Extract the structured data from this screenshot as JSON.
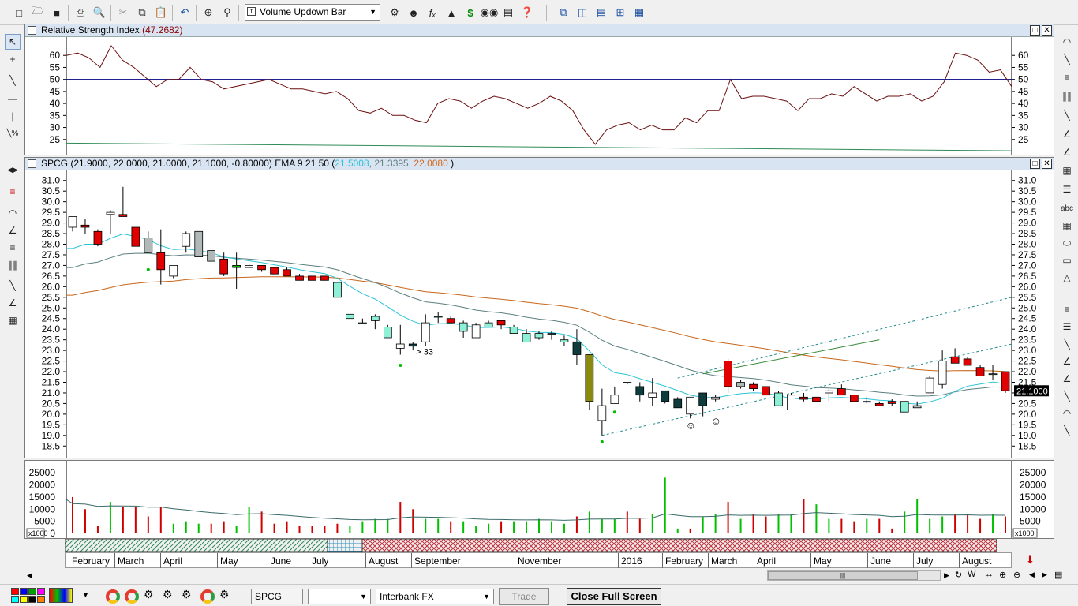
{
  "toolbar": {
    "symbol_dropdown": "Volume Updown Bar",
    "icons": [
      "new-icon",
      "open-icon",
      "save-icon",
      "print-icon",
      "print-preview-icon",
      "cut-icon",
      "copy-icon",
      "paste-icon",
      "undo-icon",
      "crosshair-icon",
      "zoom-icon",
      "indicator-icon",
      "expert-icon",
      "function-icon",
      "chart-icon",
      "dollar-icon",
      "binoculars-icon",
      "properties-icon",
      "help-icon",
      "window-cascade-icon",
      "tile-vertical-icon",
      "tile-horizontal-icon",
      "tile-grid-icon",
      "arrange-icon"
    ]
  },
  "rsi_panel": {
    "title_prefix": "Relative Strength Index",
    "title_value": "(47.2682)",
    "y_ticks": [
      "60",
      "55",
      "50",
      "45",
      "40",
      "35",
      "30",
      "25"
    ]
  },
  "price_panel": {
    "title_prefix": "SPCG (21.9000, 22.0000, 21.0000, 21.1000, -0.80000)",
    "title_ema": "EMA 9 21 50 (",
    "ema1": "21.5008",
    "ema2": "21.3395",
    "ema3": "22.0080",
    "title_close": ")",
    "y_ticks": [
      "31.0",
      "30.5",
      "30.0",
      "29.5",
      "29.0",
      "28.5",
      "28.0",
      "27.5",
      "27.0",
      "26.5",
      "26.0",
      "25.5",
      "25.0",
      "24.5",
      "24.0",
      "23.5",
      "23.0",
      "22.5",
      "22.0",
      "21.5",
      "21.0",
      "20.5",
      "20.0",
      "19.5",
      "19.0",
      "18.5"
    ],
    "last_price": "21.1000",
    "annotation": "> 33"
  },
  "volume_panel": {
    "y_ticks": [
      "25000",
      "20000",
      "15000",
      "10000",
      "5000",
      "0"
    ],
    "unit": "x1000"
  },
  "time_axis": {
    "labels": [
      "February",
      "March",
      "April",
      "May",
      "June",
      "July",
      "August",
      "September",
      "November",
      "2016",
      "February",
      "March",
      "April",
      "May",
      "June",
      "July",
      "August"
    ]
  },
  "status": {
    "symbol": "SPCG",
    "empty_dropdown": "",
    "feed": "Interbank FX",
    "trade_button": "Trade",
    "close_full_screen": "Close Full Screen",
    "palette_colors": [
      "#ff0000",
      "#0000ff",
      "#00a000",
      "#ff00ff",
      "#00ffff",
      "#ffff00",
      "#000000",
      "#ff8000"
    ]
  },
  "scroll_controls": [
    "W",
    "↔",
    "⊕",
    "⊖",
    "◀",
    "▶",
    "▤"
  ],
  "chart_data": {
    "type": "candlestick",
    "candles": [
      [
        29.3,
        29.3,
        28.6,
        28.8,
        "w"
      ],
      [
        28.9,
        29.2,
        28.5,
        28.8,
        "r"
      ],
      [
        28.6,
        28.7,
        27.9,
        28.0,
        "r"
      ],
      [
        29.5,
        29.6,
        28.5,
        29.4,
        "w"
      ],
      [
        29.4,
        30.7,
        29.3,
        29.3,
        "r"
      ],
      [
        28.8,
        28.4,
        28.4,
        27.9,
        "r"
      ],
      [
        28.3,
        28.6,
        27.8,
        27.6,
        "g"
      ],
      [
        27.6,
        28.7,
        26.1,
        26.8,
        "r"
      ],
      [
        26.5,
        27.0,
        26.4,
        27.0,
        "w"
      ],
      [
        28.5,
        28.6,
        27.6,
        27.9,
        "w"
      ],
      [
        28.6,
        27.8,
        27.6,
        27.4,
        "g"
      ],
      [
        27.7,
        27.7,
        27.2,
        27.2,
        "g"
      ],
      [
        27.3,
        27.6,
        26.5,
        26.6,
        "r"
      ],
      [
        27.0,
        27.6,
        25.9,
        26.9,
        "G"
      ],
      [
        27.0,
        27.1,
        26.9,
        26.9,
        "w"
      ],
      [
        27.0,
        27.0,
        26.7,
        26.8,
        "r"
      ],
      [
        26.9,
        26.8,
        26.6,
        26.6,
        "r"
      ],
      [
        26.8,
        26.9,
        26.6,
        26.5,
        "r"
      ],
      [
        26.5,
        26.6,
        26.3,
        26.3,
        "r"
      ],
      [
        26.5,
        26.5,
        26.3,
        26.3,
        "r"
      ],
      [
        26.5,
        26.5,
        26.4,
        26.3,
        "r"
      ],
      [
        26.2,
        26.2,
        25.8,
        25.5,
        "c"
      ],
      [
        24.7,
        24.7,
        24.5,
        24.5,
        "c"
      ],
      [
        24.3,
        24.5,
        24.3,
        24.3,
        "c"
      ],
      [
        24.6,
        24.7,
        24.0,
        24.4,
        "c"
      ],
      [
        24.1,
        24.2,
        23.7,
        23.6,
        "c"
      ],
      [
        23.3,
        24.2,
        22.8,
        23.1,
        "w"
      ],
      [
        23.3,
        23.4,
        23.0,
        23.2,
        "k"
      ],
      [
        24.3,
        24.7,
        23.2,
        23.4,
        "w"
      ],
      [
        24.6,
        24.8,
        24.3,
        24.6,
        "c"
      ],
      [
        24.5,
        24.6,
        24.3,
        24.3,
        "r"
      ],
      [
        24.3,
        24.4,
        23.6,
        23.9,
        "c"
      ],
      [
        24.2,
        24.3,
        23.9,
        23.6,
        "w"
      ],
      [
        24.3,
        24.4,
        24.1,
        24.1,
        "c"
      ],
      [
        24.4,
        24.4,
        24.0,
        24.2,
        "r"
      ],
      [
        24.1,
        24.2,
        23.9,
        23.8,
        "c"
      ],
      [
        23.8,
        24.0,
        23.4,
        23.4,
        "c"
      ],
      [
        23.8,
        23.9,
        23.5,
        23.6,
        "c"
      ],
      [
        23.8,
        23.9,
        23.5,
        23.8,
        "c"
      ],
      [
        23.5,
        23.7,
        23.2,
        23.4,
        "c"
      ],
      [
        23.4,
        24.0,
        22.3,
        22.8,
        "k"
      ],
      [
        22.8,
        22.8,
        20.2,
        20.6,
        "o"
      ],
      [
        20.4,
        21.2,
        19.0,
        19.7,
        "w"
      ],
      [
        20.9,
        21.3,
        20.5,
        20.5,
        "w"
      ],
      [
        21.5,
        21.5,
        21.4,
        21.5,
        "k"
      ],
      [
        21.3,
        21.5,
        20.6,
        20.9,
        "k"
      ],
      [
        21.0,
        21.7,
        20.4,
        20.8,
        "w"
      ],
      [
        21.1,
        21.1,
        20.5,
        20.6,
        "k"
      ],
      [
        20.7,
        20.8,
        20.7,
        20.3,
        "k"
      ],
      [
        20.8,
        20.8,
        19.8,
        20.0,
        "w"
      ],
      [
        21.0,
        21.0,
        19.9,
        20.4,
        "k"
      ],
      [
        20.8,
        20.9,
        20.6,
        20.7,
        "w"
      ],
      [
        22.5,
        22.6,
        21.0,
        21.3,
        "r"
      ],
      [
        21.5,
        21.6,
        21.2,
        21.3,
        "g"
      ],
      [
        21.4,
        21.5,
        21.1,
        21.2,
        "r"
      ],
      [
        21.3,
        21.2,
        21.0,
        20.9,
        "r"
      ],
      [
        21.0,
        21.1,
        20.6,
        20.4,
        "c"
      ],
      [
        20.9,
        21.0,
        20.5,
        20.2,
        "w"
      ],
      [
        20.8,
        21.0,
        20.6,
        20.7,
        "r"
      ],
      [
        20.8,
        20.8,
        20.6,
        20.6,
        "r"
      ],
      [
        21.1,
        21.2,
        20.6,
        21.0,
        "w"
      ],
      [
        21.2,
        21.4,
        20.9,
        20.9,
        "r"
      ],
      [
        20.9,
        20.9,
        20.6,
        20.6,
        "r"
      ],
      [
        20.6,
        20.8,
        20.5,
        20.6,
        "g"
      ],
      [
        20.5,
        20.6,
        20.4,
        20.4,
        "r"
      ],
      [
        20.6,
        20.7,
        20.4,
        20.5,
        "r"
      ],
      [
        20.6,
        20.6,
        20.3,
        20.1,
        "c"
      ],
      [
        20.4,
        20.6,
        20.3,
        20.3,
        "g"
      ],
      [
        21.7,
        21.8,
        21.0,
        21.0,
        "w"
      ],
      [
        22.5,
        23.0,
        21.2,
        21.4,
        "w"
      ],
      [
        22.7,
        23.1,
        22.4,
        22.4,
        "r"
      ],
      [
        22.6,
        22.7,
        22.4,
        22.3,
        "r"
      ],
      [
        22.2,
        22.3,
        21.8,
        21.8,
        "r"
      ],
      [
        21.9,
        22.3,
        21.6,
        21.9,
        "c"
      ],
      [
        22.0,
        22.0,
        21.0,
        21.1,
        "r"
      ]
    ],
    "volume": [
      15,
      10,
      3,
      13,
      11,
      11,
      7,
      11,
      4,
      5,
      4,
      4,
      5,
      3,
      11,
      9,
      4,
      5,
      3,
      3,
      3,
      4,
      3,
      5,
      6,
      6,
      13,
      10,
      6,
      6,
      5,
      5,
      3,
      4,
      5,
      5,
      5,
      6,
      5,
      4,
      7,
      9,
      6,
      6,
      9,
      6,
      8,
      23,
      2,
      2,
      7,
      8,
      13,
      6,
      8,
      7,
      8,
      8,
      14,
      12,
      6,
      6,
      5,
      6,
      6,
      2,
      9,
      14,
      6,
      7,
      8,
      8,
      6,
      8,
      7,
      9,
      10,
      18,
      26,
      8,
      10,
      15,
      7,
      8
    ],
    "volume_up": [
      false,
      false,
      false,
      true,
      false,
      false,
      false,
      false,
      true,
      true,
      true,
      false,
      false,
      true,
      true,
      false,
      false,
      false,
      false,
      false,
      false,
      false,
      true,
      true,
      true,
      true,
      false,
      false,
      true,
      true,
      false,
      true,
      true,
      true,
      false,
      true,
      true,
      true,
      true,
      true,
      false,
      true,
      true,
      true,
      false,
      false,
      true,
      true,
      true,
      false,
      true,
      true,
      false,
      true,
      false,
      false,
      true,
      true,
      false,
      true,
      true,
      false,
      false,
      true,
      false,
      false,
      true,
      true,
      true,
      true,
      false,
      false,
      false,
      true,
      false,
      false,
      true,
      true,
      true,
      false,
      false,
      false,
      true,
      false
    ],
    "rsi": [
      60,
      61,
      59,
      55,
      64,
      58,
      55,
      51,
      47,
      50,
      50,
      55,
      50,
      49,
      46,
      47,
      48,
      49,
      50,
      48,
      46,
      46,
      45,
      44,
      45,
      42,
      37,
      36,
      38,
      35,
      35,
      33,
      32,
      40,
      42,
      41,
      38,
      41,
      43,
      42,
      40,
      38,
      40,
      43,
      41,
      37,
      29,
      23,
      29,
      31,
      32,
      29,
      31,
      29,
      29,
      34,
      32,
      37,
      37,
      50,
      42,
      43,
      43,
      42,
      41,
      37,
      42,
      42,
      44,
      43,
      47,
      44,
      41,
      43,
      43,
      44,
      41,
      43,
      49,
      61,
      60,
      58,
      53,
      54,
      47
    ],
    "rsi_ref": 50
  }
}
